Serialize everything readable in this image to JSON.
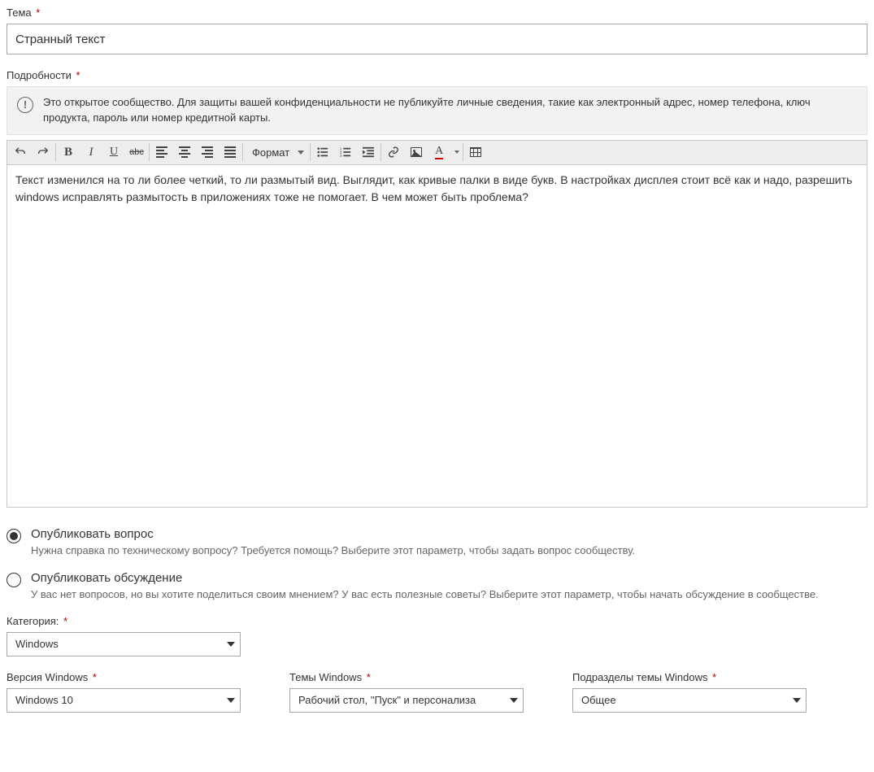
{
  "subject": {
    "label": "Тема",
    "required": "*",
    "value": "Странный текст"
  },
  "details": {
    "label": "Подробности",
    "required": "*",
    "info_banner": "Это открытое сообщество. Для защиты вашей конфиденциальности не публикуйте личные сведения, такие как электронный адрес, номер телефона, ключ продукта, пароль или номер кредитной карты.",
    "info_glyph": "!",
    "toolbar": {
      "format_label": "Формат",
      "bold_glyph": "B",
      "italic_glyph": "I",
      "underline_glyph": "U",
      "strike_glyph": "abc",
      "fontcolor_glyph": "A"
    },
    "body": "Текст изменился на то ли более четкий, то ли размытый вид. Выглядит, как кривые палки в виде букв.  В настройках дисплея стоит всё как и надо, разрешить windows исправлять размытость в приложениях тоже не помогает. В чем может быть проблема?"
  },
  "post_type": {
    "options": [
      {
        "title": "Опубликовать вопрос",
        "desc": "Нужна справка по техническому вопросу? Требуется помощь? Выберите этот параметр, чтобы задать вопрос сообществу.",
        "checked": true
      },
      {
        "title": "Опубликовать обсуждение",
        "desc": "У вас нет вопросов, но вы хотите поделиться своим мнением? У вас есть полезные советы? Выберите этот параметр, чтобы начать обсуждение в сообществе.",
        "checked": false
      }
    ]
  },
  "category": {
    "label": "Категория:",
    "required": "*",
    "value": "Windows"
  },
  "dropdowns": [
    {
      "label": "Версия Windows",
      "required": "*",
      "value": "Windows 10"
    },
    {
      "label": "Темы Windows",
      "required": "*",
      "value": "Рабочий стол, \"Пуск\" и персонализа"
    },
    {
      "label": "Подразделы темы Windows",
      "required": "*",
      "value": "Общее"
    }
  ]
}
